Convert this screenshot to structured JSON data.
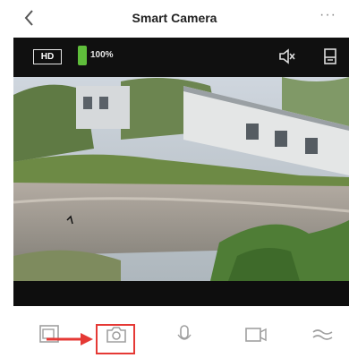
{
  "header": {
    "title": "Smart Camera",
    "back_icon": "chevron-left-icon",
    "more_label": "···"
  },
  "viewer": {
    "quality_label": "HD",
    "battery_label": "100%",
    "top_icons": [
      "speaker-mute-icon",
      "sd-card-icon"
    ]
  },
  "controls": {
    "items": [
      {
        "name": "screenshot-gallery-button",
        "icon": "gallery-icon"
      },
      {
        "name": "snapshot-button",
        "icon": "camera-icon"
      },
      {
        "name": "talk-button",
        "icon": "microphone-icon"
      },
      {
        "name": "record-button",
        "icon": "video-camera-icon"
      },
      {
        "name": "more-controls-button",
        "icon": "waves-icon"
      }
    ]
  },
  "colors": {
    "accent_red": "#e53935",
    "battery_green": "#5fbe3b",
    "viewer_bg": "#0e0e0e"
  }
}
